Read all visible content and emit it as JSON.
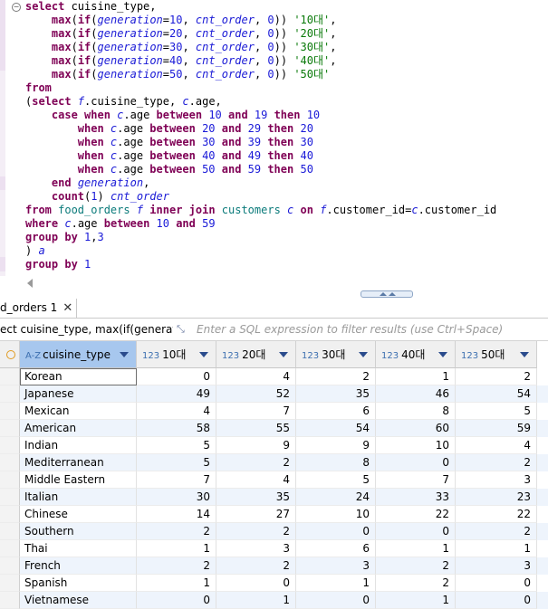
{
  "editor": {
    "lines": [
      [
        [
          "kw",
          "select "
        ],
        [
          "plain",
          "cuisine_type,"
        ]
      ],
      [
        [
          "plain",
          "    "
        ],
        [
          "fn",
          "max"
        ],
        [
          "plain",
          "("
        ],
        [
          "fn",
          "if"
        ],
        [
          "plain",
          "("
        ],
        [
          "ident",
          "generation"
        ],
        [
          "plain",
          "="
        ],
        [
          "num",
          "10"
        ],
        [
          "plain",
          ", "
        ],
        [
          "ident",
          "cnt_order"
        ],
        [
          "plain",
          ", "
        ],
        [
          "num",
          "0"
        ],
        [
          "plain",
          ")) "
        ],
        [
          "str",
          "'10대'"
        ],
        [
          "plain",
          ","
        ]
      ],
      [
        [
          "plain",
          "    "
        ],
        [
          "fn",
          "max"
        ],
        [
          "plain",
          "("
        ],
        [
          "fn",
          "if"
        ],
        [
          "plain",
          "("
        ],
        [
          "ident",
          "generation"
        ],
        [
          "plain",
          "="
        ],
        [
          "num",
          "20"
        ],
        [
          "plain",
          ", "
        ],
        [
          "ident",
          "cnt_order"
        ],
        [
          "plain",
          ", "
        ],
        [
          "num",
          "0"
        ],
        [
          "plain",
          ")) "
        ],
        [
          "str",
          "'20대'"
        ],
        [
          "plain",
          ","
        ]
      ],
      [
        [
          "plain",
          "    "
        ],
        [
          "fn",
          "max"
        ],
        [
          "plain",
          "("
        ],
        [
          "fn",
          "if"
        ],
        [
          "plain",
          "("
        ],
        [
          "ident",
          "generation"
        ],
        [
          "plain",
          "="
        ],
        [
          "num",
          "30"
        ],
        [
          "plain",
          ", "
        ],
        [
          "ident",
          "cnt_order"
        ],
        [
          "plain",
          ", "
        ],
        [
          "num",
          "0"
        ],
        [
          "plain",
          ")) "
        ],
        [
          "str",
          "'30대'"
        ],
        [
          "plain",
          ","
        ]
      ],
      [
        [
          "plain",
          "    "
        ],
        [
          "fn",
          "max"
        ],
        [
          "plain",
          "("
        ],
        [
          "fn",
          "if"
        ],
        [
          "plain",
          "("
        ],
        [
          "ident",
          "generation"
        ],
        [
          "plain",
          "="
        ],
        [
          "num",
          "40"
        ],
        [
          "plain",
          ", "
        ],
        [
          "ident",
          "cnt_order"
        ],
        [
          "plain",
          ", "
        ],
        [
          "num",
          "0"
        ],
        [
          "plain",
          ")) "
        ],
        [
          "str",
          "'40대'"
        ],
        [
          "plain",
          ","
        ]
      ],
      [
        [
          "plain",
          "    "
        ],
        [
          "fn",
          "max"
        ],
        [
          "plain",
          "("
        ],
        [
          "fn",
          "if"
        ],
        [
          "plain",
          "("
        ],
        [
          "ident",
          "generation"
        ],
        [
          "plain",
          "="
        ],
        [
          "num",
          "50"
        ],
        [
          "plain",
          ", "
        ],
        [
          "ident",
          "cnt_order"
        ],
        [
          "plain",
          ", "
        ],
        [
          "num",
          "0"
        ],
        [
          "plain",
          ")) "
        ],
        [
          "str",
          "'50대'"
        ]
      ],
      [
        [
          "kw",
          "from"
        ]
      ],
      [
        [
          "plain",
          "("
        ],
        [
          "kw",
          "select "
        ],
        [
          "ident",
          "f"
        ],
        [
          "plain",
          ".cuisine_type, "
        ],
        [
          "ident",
          "c"
        ],
        [
          "plain",
          ".age,"
        ]
      ],
      [
        [
          "plain",
          "    "
        ],
        [
          "kw",
          "case when "
        ],
        [
          "ident",
          "c"
        ],
        [
          "plain",
          ".age "
        ],
        [
          "kw",
          "between "
        ],
        [
          "num",
          "10"
        ],
        [
          "kw",
          " and "
        ],
        [
          "num",
          "19"
        ],
        [
          "kw",
          " then "
        ],
        [
          "num",
          "10"
        ]
      ],
      [
        [
          "plain",
          "        "
        ],
        [
          "kw",
          "when "
        ],
        [
          "ident",
          "c"
        ],
        [
          "plain",
          ".age "
        ],
        [
          "kw",
          "between "
        ],
        [
          "num",
          "20"
        ],
        [
          "kw",
          " and "
        ],
        [
          "num",
          "29"
        ],
        [
          "kw",
          " then "
        ],
        [
          "num",
          "20"
        ]
      ],
      [
        [
          "plain",
          "        "
        ],
        [
          "kw",
          "when "
        ],
        [
          "ident",
          "c"
        ],
        [
          "plain",
          ".age "
        ],
        [
          "kw",
          "between "
        ],
        [
          "num",
          "30"
        ],
        [
          "kw",
          " and "
        ],
        [
          "num",
          "39"
        ],
        [
          "kw",
          " then "
        ],
        [
          "num",
          "30"
        ]
      ],
      [
        [
          "plain",
          "        "
        ],
        [
          "kw",
          "when "
        ],
        [
          "ident",
          "c"
        ],
        [
          "plain",
          ".age "
        ],
        [
          "kw",
          "between "
        ],
        [
          "num",
          "40"
        ],
        [
          "kw",
          " and "
        ],
        [
          "num",
          "49"
        ],
        [
          "kw",
          " then "
        ],
        [
          "num",
          "40"
        ]
      ],
      [
        [
          "plain",
          "        "
        ],
        [
          "kw",
          "when "
        ],
        [
          "ident",
          "c"
        ],
        [
          "plain",
          ".age "
        ],
        [
          "kw",
          "between "
        ],
        [
          "num",
          "50"
        ],
        [
          "kw",
          " and "
        ],
        [
          "num",
          "59"
        ],
        [
          "kw",
          " then "
        ],
        [
          "num",
          "50"
        ]
      ],
      [
        [
          "plain",
          "    "
        ],
        [
          "kw",
          "end "
        ],
        [
          "ident",
          "generation"
        ],
        [
          "plain",
          ","
        ]
      ],
      [
        [
          "plain",
          "    "
        ],
        [
          "fn",
          "count"
        ],
        [
          "plain",
          "("
        ],
        [
          "num",
          "1"
        ],
        [
          "plain",
          ") "
        ],
        [
          "ident",
          "cnt_order"
        ]
      ],
      [
        [
          "kw",
          "from "
        ],
        [
          "tbl",
          "food_orders"
        ],
        [
          "plain",
          " "
        ],
        [
          "ident",
          "f"
        ],
        [
          "kw",
          " inner join "
        ],
        [
          "tbl",
          "customers"
        ],
        [
          "plain",
          " "
        ],
        [
          "ident",
          "c"
        ],
        [
          "kw",
          " on "
        ],
        [
          "ident",
          "f"
        ],
        [
          "plain",
          ".customer_id="
        ],
        [
          "ident",
          "c"
        ],
        [
          "plain",
          ".customer_id"
        ]
      ],
      [
        [
          "kw",
          "where "
        ],
        [
          "ident",
          "c"
        ],
        [
          "plain",
          ".age "
        ],
        [
          "kw",
          "between "
        ],
        [
          "num",
          "10"
        ],
        [
          "kw",
          " and "
        ],
        [
          "num",
          "59"
        ]
      ],
      [
        [
          "kw",
          "group by "
        ],
        [
          "num",
          "1"
        ],
        [
          "plain",
          ","
        ],
        [
          "num",
          "3"
        ]
      ],
      [
        [
          "plain",
          ") "
        ],
        [
          "ident",
          "a"
        ]
      ],
      [
        [
          "kw",
          "group by "
        ],
        [
          "num",
          "1"
        ]
      ]
    ]
  },
  "results": {
    "tab_label": "d_orders 1",
    "filter_query": "ect cuisine_type, max(if(generation=",
    "filter_placeholder": "Enter a SQL expression to filter results (use Ctrl+Space)",
    "columns": [
      {
        "type": "A-Z",
        "label": "cuisine_type"
      },
      {
        "type": "123",
        "label": "10대"
      },
      {
        "type": "123",
        "label": "20대"
      },
      {
        "type": "123",
        "label": "30대"
      },
      {
        "type": "123",
        "label": "40대"
      },
      {
        "type": "123",
        "label": "50대"
      }
    ],
    "rows": [
      [
        "Korean",
        "0",
        "4",
        "2",
        "1",
        "2"
      ],
      [
        "Japanese",
        "49",
        "52",
        "35",
        "46",
        "54"
      ],
      [
        "Mexican",
        "4",
        "7",
        "6",
        "8",
        "5"
      ],
      [
        "American",
        "58",
        "55",
        "54",
        "60",
        "59"
      ],
      [
        "Indian",
        "5",
        "9",
        "9",
        "10",
        "4"
      ],
      [
        "Mediterranean",
        "5",
        "2",
        "8",
        "0",
        "2"
      ],
      [
        "Middle Eastern",
        "7",
        "4",
        "5",
        "7",
        "3"
      ],
      [
        "Italian",
        "30",
        "35",
        "24",
        "33",
        "23"
      ],
      [
        "Chinese",
        "14",
        "27",
        "10",
        "22",
        "22"
      ],
      [
        "Southern",
        "2",
        "2",
        "0",
        "0",
        "2"
      ],
      [
        "Thai",
        "1",
        "3",
        "6",
        "1",
        "1"
      ],
      [
        "French",
        "2",
        "2",
        "3",
        "2",
        "3"
      ],
      [
        "Spanish",
        "1",
        "0",
        "1",
        "2",
        "0"
      ],
      [
        "Vietnamese",
        "0",
        "1",
        "0",
        "1",
        "0"
      ]
    ]
  }
}
